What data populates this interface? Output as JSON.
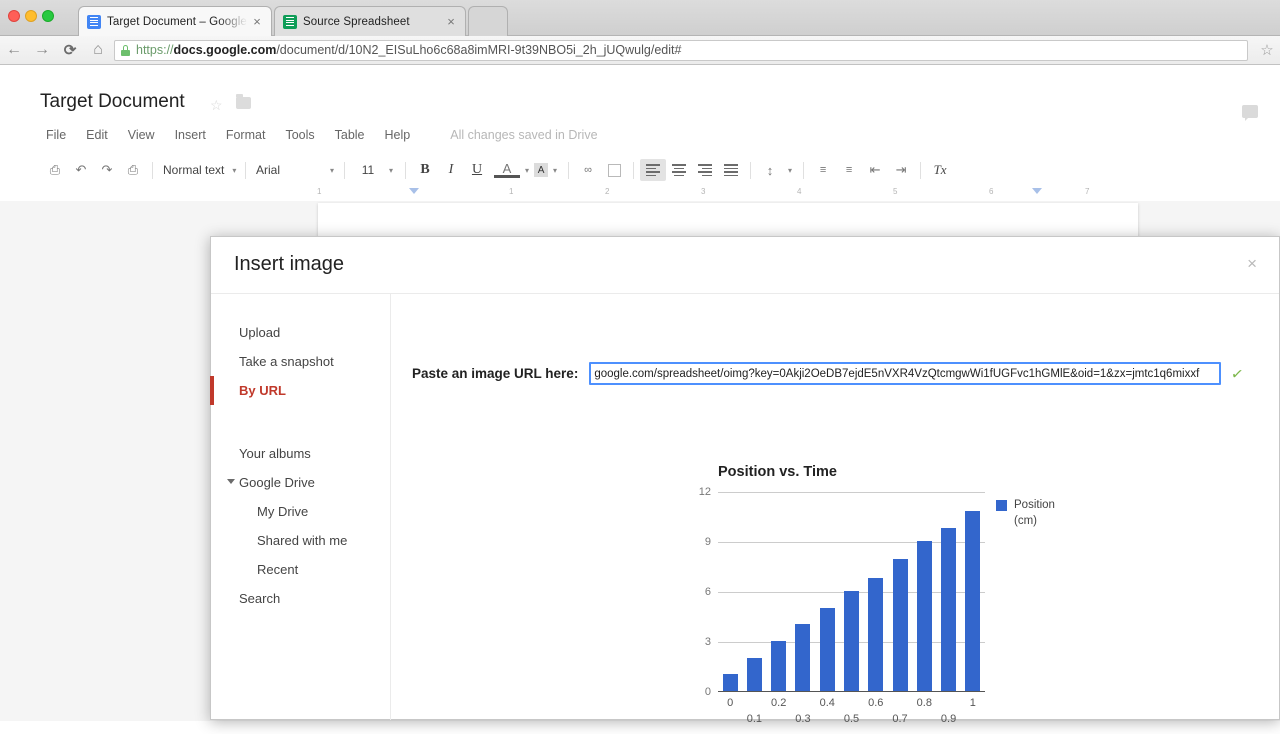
{
  "browser": {
    "tabs": [
      {
        "title": "Target Document – Google Docs",
        "favicon": "docs-icon",
        "close": "×",
        "active": true
      },
      {
        "title": "Source Spreadsheet",
        "favicon": "sheets-icon",
        "close": "×",
        "active": false
      }
    ],
    "nav": {
      "back": "←",
      "forward": "→",
      "reload": "⟳",
      "home": "⌂",
      "star": "☆"
    },
    "url": {
      "scheme": "https://",
      "host": "docs.google.com",
      "path": "/document/d/10N2_EISuLho6c68a8imMRI-9t39NBO5i_2h_jUQwulg/edit#",
      "lock": "lock-icon"
    }
  },
  "docs": {
    "title": "Target Document",
    "star": "☆",
    "folder_icon": "folder-icon",
    "comment_icon": "comment-icon",
    "menus": [
      "File",
      "Edit",
      "View",
      "Insert",
      "Format",
      "Tools",
      "Table",
      "Help"
    ],
    "save_status": "All changes saved in Drive",
    "toolbar": {
      "print": "⎙",
      "undo": "↶",
      "redo": "↷",
      "paint_format": "⎙",
      "paragraph_style": "Normal text",
      "font": "Arial",
      "font_size": "11",
      "bold": "B",
      "italic": "I",
      "underline": "U",
      "text_color": "A",
      "highlight_color": "A",
      "link": "∞",
      "comment": "▤",
      "line_spacing": "↕",
      "numbered_list": "≡",
      "bulleted_list": "≡",
      "decrease_indent": "⇤",
      "increase_indent": "⇥",
      "clear_formatting": "Tx",
      "caret": "▾"
    },
    "ruler_numbers": [
      "1",
      "2",
      "3",
      "4",
      "5",
      "6",
      "7"
    ]
  },
  "modal": {
    "title": "Insert image",
    "close": "×",
    "sidebar": [
      {
        "label": "Upload",
        "selected": false,
        "sub": false
      },
      {
        "label": "Take a snapshot",
        "selected": false,
        "sub": false
      },
      {
        "label": "By URL",
        "selected": true,
        "sub": false
      }
    ],
    "sidebar2": [
      {
        "label": "Your albums",
        "sub": false,
        "caret": false
      },
      {
        "label": "Google Drive",
        "sub": false,
        "caret": true
      },
      {
        "label": "My Drive",
        "sub": true,
        "caret": false
      },
      {
        "label": "Shared with me",
        "sub": true,
        "caret": false
      },
      {
        "label": "Recent",
        "sub": true,
        "caret": false
      },
      {
        "label": "Search",
        "sub": false,
        "caret": false
      }
    ],
    "url_label": "Paste an image URL here:",
    "url_value": "google.com/spreadsheet/oimg?key=0Akji2OeDB7ejdE5nVXR4VzQtcmgwWi1fUGFvc1hGMlE&oid=1&zx=jmtc1q6mixxf",
    "url_placeholder": "Paste an image URL here",
    "valid_check": "✓"
  },
  "chart_data": {
    "type": "bar",
    "title": "Position vs. Time",
    "xlabel": "",
    "ylabel": "",
    "categories": [
      "0",
      "0.1",
      "0.2",
      "0.3",
      "0.4",
      "0.5",
      "0.6",
      "0.7",
      "0.8",
      "0.9",
      "1"
    ],
    "values": [
      1,
      2,
      3,
      4,
      5,
      6,
      6.8,
      7.9,
      9,
      9.8,
      10.8
    ],
    "series": [
      {
        "name": "Position (cm)",
        "values": [
          1,
          2,
          3,
          4,
          5,
          6,
          6.8,
          7.9,
          9,
          9.8,
          10.8
        ]
      }
    ],
    "yticks": [
      0,
      3,
      6,
      9,
      12
    ],
    "ylim": [
      0,
      12
    ],
    "grid": true,
    "legend_position": "right",
    "legend": [
      "Position",
      "(cm)"
    ],
    "bar_color": "#3366cc"
  }
}
